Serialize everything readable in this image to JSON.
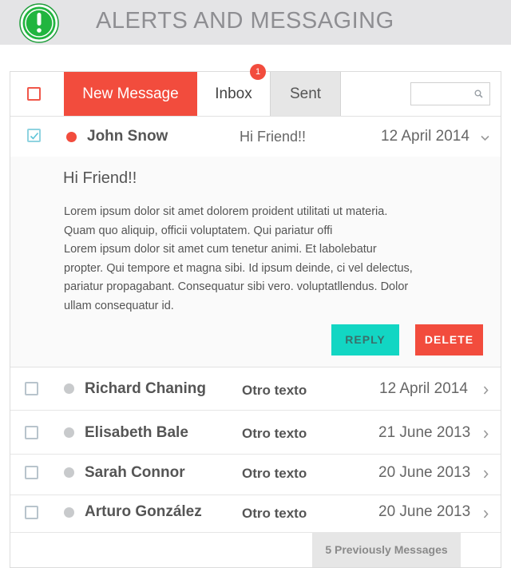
{
  "header": {
    "title": "ALERTS AND MESSAGING",
    "logo_icon": "alert-exclamation-icon",
    "accent": "#21b53f"
  },
  "toolbar": {
    "new_message": "New Message",
    "inbox": "Inbox",
    "inbox_badge": "1",
    "sent": "Sent",
    "search_placeholder": ""
  },
  "open_message": {
    "sender": "John Snow",
    "subject": "Hi Friend!!",
    "date": "12 April 2014",
    "title": "Hi Friend!!",
    "body": [
      "Lorem ipsum dolor sit amet dolorem proident utilitati ut materia.",
      "Quam quo aliquip, officii voluptatem. Qui pariatur offi",
      "Lorem ipsum dolor sit amet cum tenetur animi. Et labolebatur",
      "propter. Qui tempore et magna sibi. Id ipsum deinde, ci vel delectus,",
      "pariatur propagabant. Consequatur sibi vero. voluptatllendus. Dolor",
      "ullam consequatur id."
    ],
    "reply_label": "REPLY",
    "delete_label": "DELETE"
  },
  "messages": [
    {
      "sender": "Richard Chaning",
      "subject": "Otro texto",
      "date": "12 April 2014"
    },
    {
      "sender": "Elisabeth Bale",
      "subject": "Otro texto",
      "date": "21 June 2013"
    },
    {
      "sender": "Sarah Connor",
      "subject": "Otro texto",
      "date": "20 June 2013"
    },
    {
      "sender": "Arturo González",
      "subject": "Otro texto",
      "date": "20 June 2013"
    }
  ],
  "footer": {
    "more_label": "5 Previously Messages"
  },
  "colors": {
    "red": "#f24c3d",
    "teal": "#12d6c3",
    "grey": "#c8cacc"
  }
}
